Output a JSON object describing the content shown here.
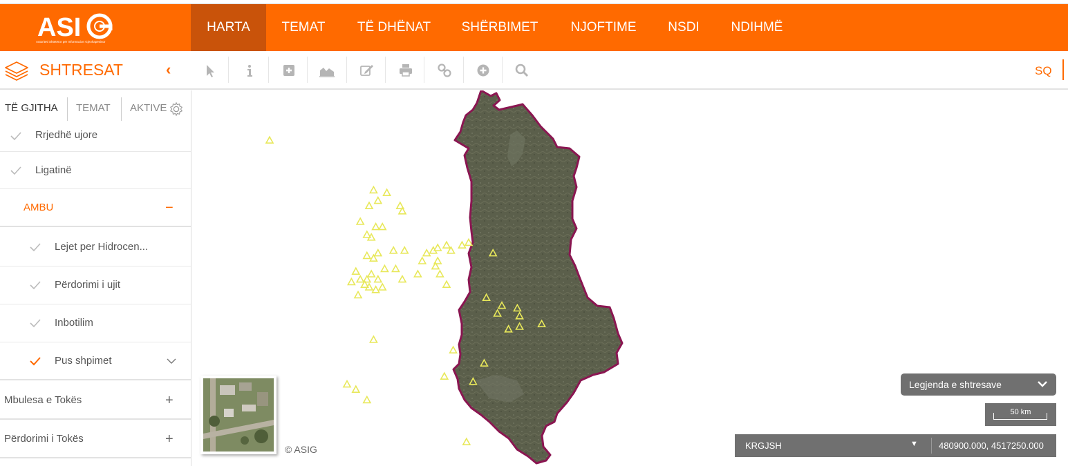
{
  "logo": {
    "text": "ASIG",
    "subtitle": "Autoriteti Shtetëror për Informacion Gjeohapësinor"
  },
  "nav": {
    "items": [
      {
        "label": "HARTA",
        "active": true
      },
      {
        "label": "TEMAT"
      },
      {
        "label": "TË DHËNAT"
      },
      {
        "label": "SHËRBIMET"
      },
      {
        "label": "NJOFTIME"
      },
      {
        "label": "NSDI"
      },
      {
        "label": "NDIHMË"
      }
    ]
  },
  "toolbar": {
    "panel_title": "SHTRESAT",
    "collapse_symbol": "‹",
    "language": "SQ",
    "tools": [
      "select-pointer-icon",
      "info-icon",
      "add-box-icon",
      "area-chart-icon",
      "edit-icon",
      "print-icon",
      "link-icon",
      "add-circle-icon",
      "search-icon"
    ]
  },
  "sidebar": {
    "tabs": [
      {
        "label": "TË GJITHA",
        "active": true
      },
      {
        "label": "TEMAT"
      },
      {
        "label": "AKTIVE"
      }
    ],
    "layers": [
      {
        "label": "Rrjedhë ujore",
        "checked": false
      },
      {
        "label": "Ligatinë",
        "checked": false
      },
      {
        "label": "AMBU",
        "group": true,
        "symbol": "−"
      },
      {
        "label": "Lejet per Hidrocen...",
        "checked": false
      },
      {
        "label": "Përdorimi i ujit",
        "checked": false
      },
      {
        "label": "Inbotilim",
        "checked": false
      },
      {
        "label": "Pus shpimet",
        "checked": true,
        "symbol": "⌄"
      },
      {
        "label": "Mbulesa e Tokës",
        "symbol": "+"
      },
      {
        "label": "Përdorimi i Tokës",
        "symbol": "+"
      }
    ]
  },
  "map": {
    "copyright": "© ASIG",
    "legend_button": "Legjenda e shtresave",
    "legend_chevron": "❯",
    "scale_label": "50 km",
    "crs": "KRGJSH",
    "crs_arrow": "▼",
    "coordinates": "480900.000, 4517250.000",
    "border_color": "#8a1651",
    "terrain_color": "#5a5e4a",
    "marker_color": "#e8e85a",
    "markers": [
      [
        0.35,
        0.19
      ],
      [
        0.82,
        0.38
      ],
      [
        0.88,
        0.39
      ],
      [
        0.84,
        0.42
      ],
      [
        0.8,
        0.44
      ],
      [
        0.94,
        0.44
      ],
      [
        0.95,
        0.46
      ],
      [
        0.76,
        0.5
      ],
      [
        0.83,
        0.52
      ],
      [
        0.86,
        0.52
      ],
      [
        0.79,
        0.55
      ],
      [
        0.81,
        0.56
      ],
      [
        0.91,
        0.61
      ],
      [
        0.96,
        0.61
      ],
      [
        0.84,
        0.62
      ],
      [
        0.79,
        0.63
      ],
      [
        0.82,
        0.64
      ],
      [
        0.87,
        0.68
      ],
      [
        0.92,
        0.68
      ],
      [
        0.74,
        0.69
      ],
      [
        0.81,
        0.7
      ],
      [
        0.79,
        0.72
      ],
      [
        0.84,
        0.72
      ],
      [
        0.76,
        0.72
      ],
      [
        0.8,
        0.75
      ],
      [
        0.78,
        0.74
      ],
      [
        0.75,
        0.78
      ],
      [
        0.83,
        0.76
      ],
      [
        0.72,
        0.73
      ],
      [
        0.86,
        0.75
      ],
      [
        0.95,
        0.72
      ],
      [
        1.02,
        0.7
      ],
      [
        1.04,
        0.65
      ],
      [
        1.06,
        0.62
      ],
      [
        1.09,
        0.61
      ],
      [
        1.15,
        0.59
      ],
      [
        1.11,
        0.6
      ],
      [
        1.17,
        0.61
      ],
      [
        1.22,
        0.59
      ],
      [
        1.25,
        0.58
      ],
      [
        1.11,
        0.65
      ],
      [
        1.1,
        0.67
      ],
      [
        1.12,
        0.7
      ],
      [
        1.15,
        0.74
      ],
      [
        1.36,
        0.62
      ],
      [
        1.4,
        0.82
      ],
      [
        1.38,
        0.85
      ],
      [
        1.33,
        0.79
      ],
      [
        1.47,
        0.83
      ],
      [
        1.48,
        0.86
      ],
      [
        1.48,
        0.9
      ],
      [
        1.43,
        0.91
      ],
      [
        1.58,
        0.89
      ],
      [
        0.82,
        0.95
      ],
      [
        1.18,
        0.99
      ],
      [
        1.32,
        1.04
      ],
      [
        1.14,
        1.09
      ],
      [
        1.27,
        1.11
      ],
      [
        0.7,
        1.12
      ],
      [
        0.74,
        1.14
      ],
      [
        0.79,
        1.18
      ],
      [
        1.24,
        1.34
      ]
    ]
  }
}
